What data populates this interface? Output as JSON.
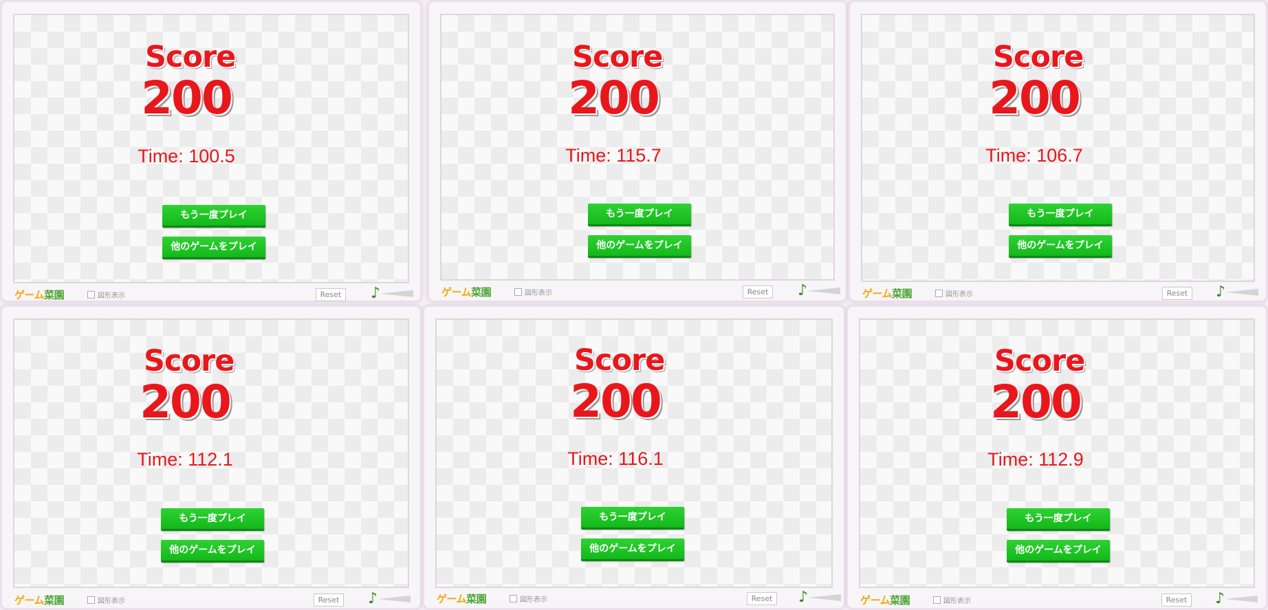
{
  "panels": [
    {
      "score_label": "Score",
      "score": "200",
      "time": "Time: 100.5"
    },
    {
      "score_label": "Score",
      "score": "200",
      "time": "Time: 115.7"
    },
    {
      "score_label": "Score",
      "score": "200",
      "time": "Time: 106.7"
    },
    {
      "score_label": "Score",
      "score": "200",
      "time": "Time: 112.1"
    },
    {
      "score_label": "Score",
      "score": "200",
      "time": "Time: 116.1"
    },
    {
      "score_label": "Score",
      "score": "200",
      "time": "Time: 112.9"
    }
  ],
  "buttons": {
    "replay": "もう一度プレイ",
    "other_games": "他のゲームをプレイ"
  },
  "footer": {
    "logo_part1": "ゲーム",
    "logo_part2": "菜園",
    "show_shapes": "図形表示",
    "reset": "Reset",
    "music_icon": "♪"
  },
  "colors": {
    "score_text": "#e8171c",
    "button_green": "#13b81a",
    "logo_orange": "#f5a70c",
    "logo_green": "#4ba534"
  }
}
